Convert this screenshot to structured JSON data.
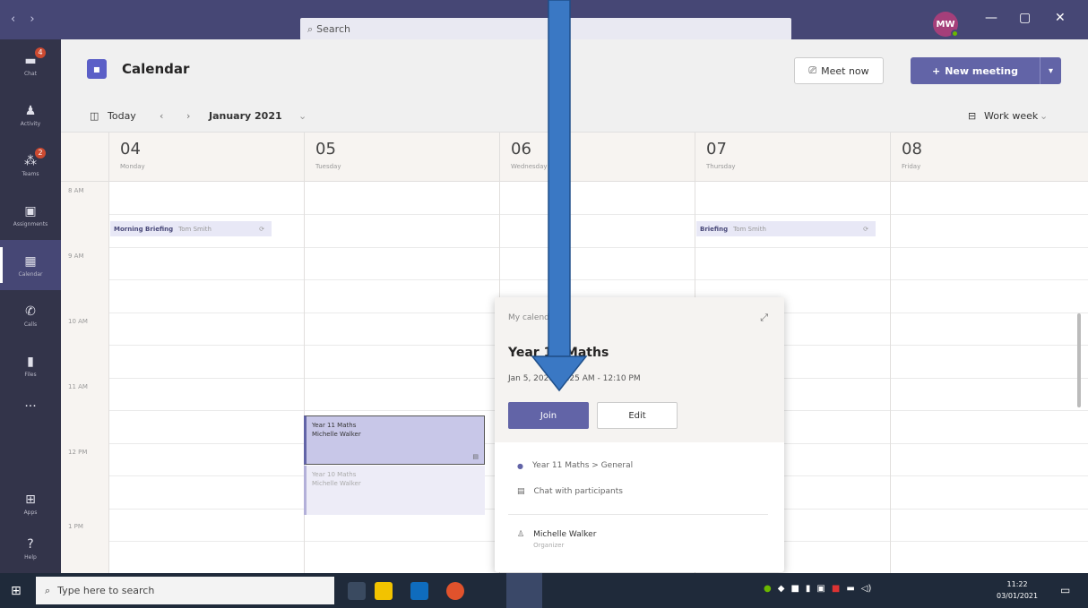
{
  "titlebar": {
    "nav": "‹ ›",
    "search_placeholder": "Search",
    "avatar_initials": "MW"
  },
  "rail": [
    {
      "label": "Chat",
      "icon": "chat-icon",
      "badge": "4"
    },
    {
      "label": "Activity",
      "icon": "bell-icon",
      "badge": ""
    },
    {
      "label": "Teams",
      "icon": "teams-icon",
      "badge": "2"
    },
    {
      "label": "Assignments",
      "icon": "assignments-icon",
      "badge": ""
    },
    {
      "label": "Calendar",
      "icon": "calendar-icon",
      "badge": ""
    },
    {
      "label": "Calls",
      "icon": "phone-icon",
      "badge": ""
    },
    {
      "label": "Files",
      "icon": "file-icon",
      "badge": ""
    },
    {
      "label": "...",
      "icon": "more-icon",
      "badge": ""
    },
    {
      "label": "Apps",
      "icon": "apps-icon",
      "badge": ""
    },
    {
      "label": "Help",
      "icon": "help-icon",
      "badge": ""
    }
  ],
  "header": {
    "title": "Calendar",
    "meet_now": "Meet now",
    "new_meeting": "New meeting"
  },
  "toolbar": {
    "today": "Today",
    "month": "January 2021",
    "view": "Work week"
  },
  "days": [
    {
      "num": "04",
      "name": "Monday"
    },
    {
      "num": "05",
      "name": "Tuesday"
    },
    {
      "num": "06",
      "name": "Wednesday"
    },
    {
      "num": "07",
      "name": "Thursday"
    },
    {
      "num": "08",
      "name": "Friday"
    }
  ],
  "times": [
    "8 AM",
    "9 AM",
    "10 AM",
    "11 AM",
    "12 PM",
    "1 PM"
  ],
  "events": {
    "mon_title": "Morning Briefing",
    "mon_org": "Tom Smith",
    "thu_title": "Briefing",
    "thu_org": "Tom Smith",
    "tue1_title": "Year 11 Maths",
    "tue1_org": "Michelle Walker",
    "tue2_title": "Year 10 Maths",
    "tue2_org": "Michelle Walker"
  },
  "popup": {
    "calendar": "My calendar",
    "title": "Year 11 Maths",
    "time": "Jan 5, 2021 11:25 AM - 12:10 PM",
    "join": "Join",
    "edit": "Edit",
    "channel": "Year 11 Maths > General",
    "chat": "Chat with participants",
    "organizer_name": "Michelle Walker",
    "organizer_role": "Organizer"
  },
  "taskbar": {
    "search_placeholder": "Type here to search",
    "time": "11:22",
    "date": "03/01/2021"
  },
  "colors": {
    "accent": "#6264a7",
    "titlebar": "#464775",
    "rail": "#33344a",
    "arrow": "#3a78c4"
  }
}
